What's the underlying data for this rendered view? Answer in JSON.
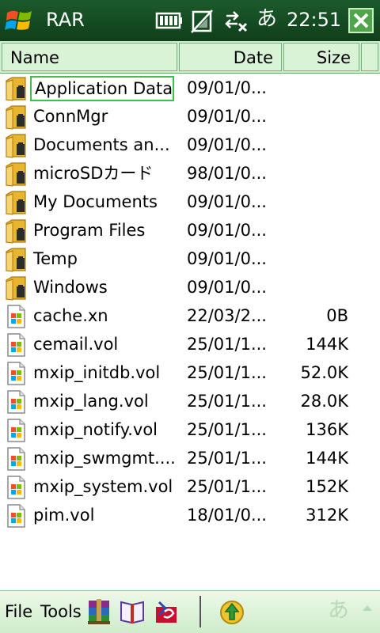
{
  "window": {
    "title": "RAR",
    "status": {
      "ime": "あ",
      "time": "22:51"
    }
  },
  "columns": {
    "name": "Name",
    "date": "Date",
    "size": "Size"
  },
  "files": [
    {
      "name": "Application Data",
      "date": "09/01/0...",
      "size": "",
      "icon": "folder-icon",
      "selected": true
    },
    {
      "name": "ConnMgr",
      "date": "09/01/0...",
      "size": "",
      "icon": "folder-icon"
    },
    {
      "name": "Documents an...",
      "date": "09/01/0...",
      "size": "",
      "icon": "folder-icon"
    },
    {
      "name": "microSDカード",
      "date": "98/01/0...",
      "size": "",
      "icon": "folder-icon"
    },
    {
      "name": "My Documents",
      "date": "09/01/0...",
      "size": "",
      "icon": "folder-icon"
    },
    {
      "name": "Program Files",
      "date": "09/01/0...",
      "size": "",
      "icon": "folder-icon"
    },
    {
      "name": "Temp",
      "date": "09/01/0...",
      "size": "",
      "icon": "folder-icon"
    },
    {
      "name": "Windows",
      "date": "09/01/0...",
      "size": "",
      "icon": "folder-icon"
    },
    {
      "name": "cache.xn",
      "date": "22/03/2...",
      "size": "0B",
      "icon": "file-icon"
    },
    {
      "name": "cemail.vol",
      "date": "25/01/1...",
      "size": "144K",
      "icon": "file-icon"
    },
    {
      "name": "mxip_initdb.vol",
      "date": "25/01/1...",
      "size": "52.0K",
      "icon": "file-icon"
    },
    {
      "name": "mxip_lang.vol",
      "date": "25/01/1...",
      "size": "28.0K",
      "icon": "file-icon"
    },
    {
      "name": "mxip_notify.vol",
      "date": "25/01/1...",
      "size": "136K",
      "icon": "file-icon"
    },
    {
      "name": "mxip_swmgmt....",
      "date": "25/01/1...",
      "size": "144K",
      "icon": "file-icon"
    },
    {
      "name": "mxip_system.vol",
      "date": "25/01/1...",
      "size": "152K",
      "icon": "file-icon"
    },
    {
      "name": "pim.vol",
      "date": "18/01/0...",
      "size": "312K",
      "icon": "file-icon"
    }
  ],
  "menubar": {
    "file": "File",
    "tools": "Tools",
    "ime": "あ"
  },
  "colors": {
    "titlebar": "#164c22",
    "header": "#cfeecf",
    "selection_border": "#3fbf4f",
    "close_button": "#4fa64a"
  }
}
